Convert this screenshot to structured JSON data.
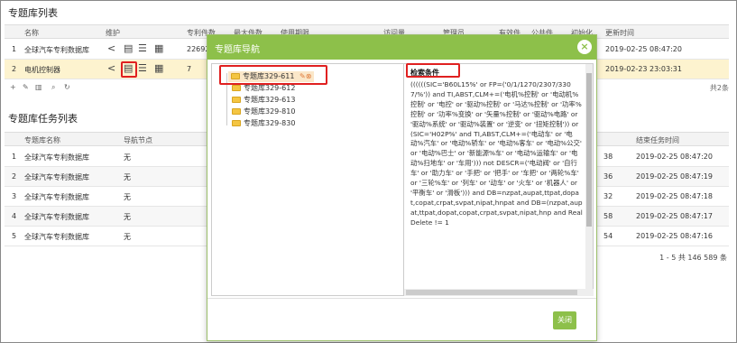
{
  "section1": {
    "title": "专题库列表",
    "headers": {
      "name": "名称",
      "maintain": "维护",
      "patents": "专利件数",
      "max": "最大件数",
      "expire": "使用期限",
      "visits": "访问量",
      "admin": "管理员",
      "valid": "有效件",
      "public": "公共件",
      "initial": "初始化",
      "updated": "更新时间"
    },
    "rows": [
      {
        "idx": "1",
        "name": "全球汽车专利数据库",
        "patents": "22692",
        "updated": "2019-02-25 08:47:20"
      },
      {
        "idx": "2",
        "name": "电机控制器",
        "patents": "7",
        "updated": "2019-02-23 23:03:31"
      }
    ],
    "total": "共2条"
  },
  "section2": {
    "title": "专题库任务列表",
    "headers": {
      "name": "专题库名称",
      "nav": "导航节点",
      "end": "结束任务时间"
    },
    "rows": [
      {
        "idx": "1",
        "name": "全球汽车专利数据库",
        "nav": "无",
        "mid": "38",
        "end": "2019-02-25 08:47:20"
      },
      {
        "idx": "2",
        "name": "全球汽车专利数据库",
        "nav": "无",
        "mid": "36",
        "end": "2019-02-25 08:47:19"
      },
      {
        "idx": "3",
        "name": "全球汽车专利数据库",
        "nav": "无",
        "mid": "32",
        "end": "2019-02-25 08:47:18"
      },
      {
        "idx": "4",
        "name": "全球汽车专利数据库",
        "nav": "无",
        "mid": "58",
        "end": "2019-02-25 08:47:17"
      },
      {
        "idx": "5",
        "name": "全球汽车专利数据库",
        "nav": "无",
        "mid": "54",
        "end": "2019-02-25 08:47:16"
      }
    ],
    "pager": "1 - 5   共 146 589 条"
  },
  "modal": {
    "title": "专题库导航",
    "close_symbol": "×",
    "tree": [
      "专题库329-611",
      "专题库329-612",
      "专题库329-613",
      "专题库329-810",
      "专题库329-830"
    ],
    "detail_title": "检索条件",
    "detail_body": "((((((SIC='B60L15%' or FP=('0/1/1270/2307/3307/%')) and TI,ABST,CLM+=('电机%控制' or '电动机%控制' or '电控' or '驱动%控制' or '马达%控制' or '功率%控制' or '功率%变换' or '矢量%控制' or '驱动%电路' or '驱动%系统' or '驱动%装置' or '逆变' or '扭矩控制')) or (SIC='H02P%' and TI,ABST,CLM+=('电动车' or '电动%汽车' or '电动%轿车' or '电动%客车' or '电动%公交' or '电动%巴士' or '新能源%车' or '电动%运输车' or '电动%扫地车' or '车用'))) not DESCR=('电动阀' or '自行车' or '助力车' or '手把' or '把手' or '车把' or '两轮%车' or '三轮%车' or '列车' or '动车' or '火车' or '机器人' or '平衡车' or '滑板'))) and DB=nzpat,aupat,ttpat,dopat,copat,crpat,svpat,nipat,hnpat and DB=(nzpat,aupat,ttpat,dopat,copat,crpat,svpat,nipat,hnp and RealDelete != 1",
    "close_button": "关闭"
  },
  "colors": {
    "header_green": "#8dc04a",
    "highlight_row": "#fdf3cf",
    "annotation_red": "#e02020"
  }
}
